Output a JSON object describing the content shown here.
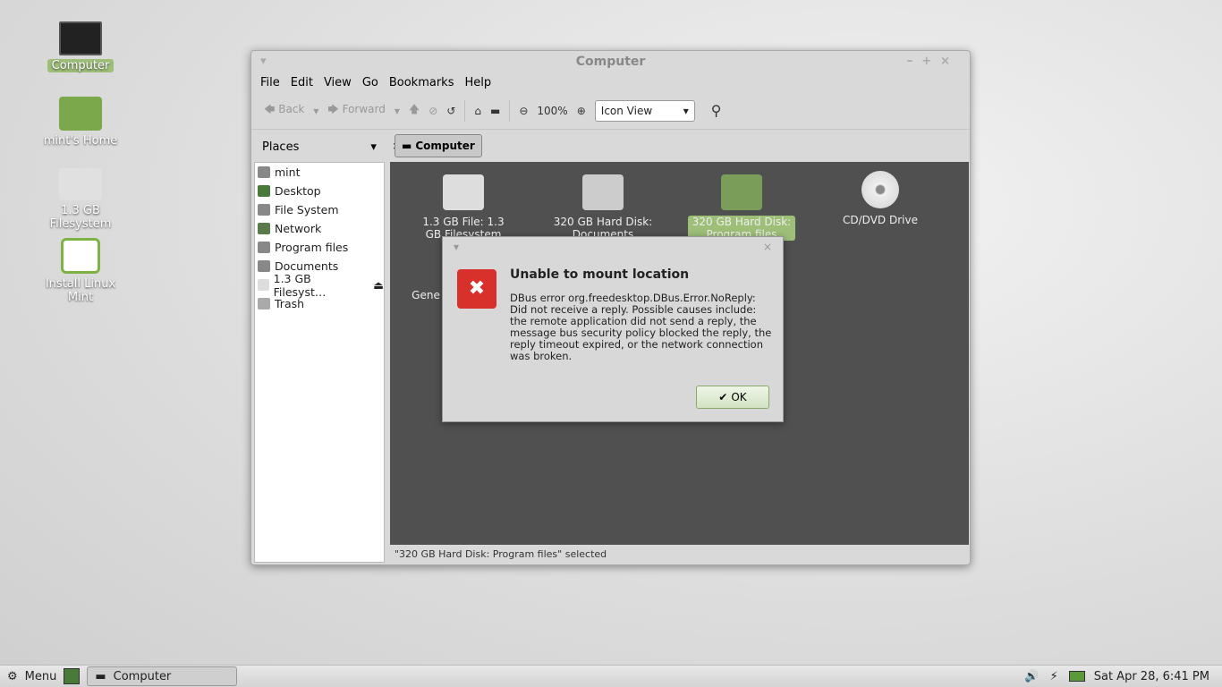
{
  "desktop": {
    "icons": [
      {
        "label": "Computer"
      },
      {
        "label": "mint's Home"
      },
      {
        "label": "1.3 GB Filesystem"
      },
      {
        "label": "Install Linux Mint"
      }
    ]
  },
  "window": {
    "title": "Computer",
    "menu": [
      "File",
      "Edit",
      "View",
      "Go",
      "Bookmarks",
      "Help"
    ],
    "toolbar": {
      "back": "Back",
      "forward": "Forward",
      "zoom": "100%",
      "view_mode": "Icon View"
    },
    "places_label": "Places",
    "path_button": "Computer",
    "sidebar": [
      "mint",
      "Desktop",
      "File System",
      "Network",
      "Program files",
      "Documents",
      "1.3 GB Filesyst…",
      "Trash"
    ],
    "files": [
      {
        "label": "1.3 GB File: 1.3 GB Filesystem"
      },
      {
        "label": "320 GB Hard Disk: Documents"
      },
      {
        "label": "320 GB Hard Disk: Program files",
        "selected": true
      },
      {
        "label": "CD/DVD Drive"
      },
      {
        "label": "Gene"
      }
    ],
    "status": "\"320 GB Hard Disk: Program files\" selected"
  },
  "dialog": {
    "title": "Unable to mount location",
    "message": "DBus error org.freedesktop.DBus.Error.NoReply: Did not receive a reply. Possible causes include: the remote application did not send a reply, the message bus security policy blocked the reply, the reply timeout expired, or the network connection was broken.",
    "ok": "OK"
  },
  "taskbar": {
    "menu": "Menu",
    "window": "Computer",
    "clock": "Sat Apr 28, 6:41 PM"
  },
  "colors": {
    "accent": "#9dbf77",
    "error": "#d8312b"
  }
}
